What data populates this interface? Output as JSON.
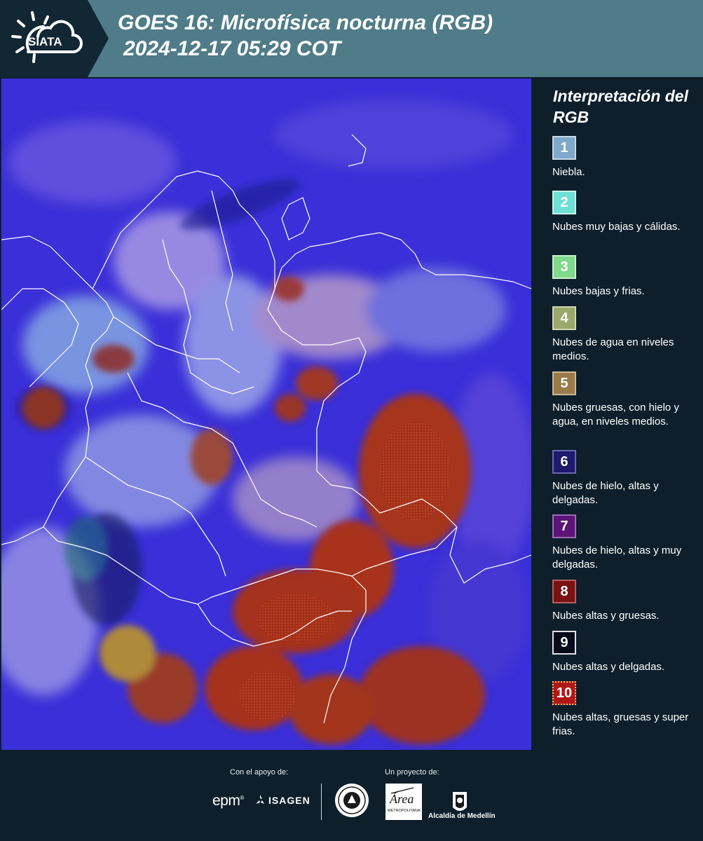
{
  "header": {
    "logo_text": "SIATA",
    "title_line1": "GOES 16: Microfísica nocturna (RGB)",
    "title_line2": "2024-12-17 05:29 COT"
  },
  "legend": {
    "title": "Interpretación del RGB",
    "items": [
      {
        "number": "1",
        "label": "Niebla.",
        "color": "#7fa8cc"
      },
      {
        "number": "2",
        "label": "Nubes muy bajas y cálidas.",
        "color": "#6fe0d4"
      },
      {
        "number": "3",
        "label": "Nubes bajas y frias.",
        "color": "#7fd88c"
      },
      {
        "number": "4",
        "label": "Nubes de agua en niveles medios.",
        "color": "#9aa86c"
      },
      {
        "number": "5",
        "label": "Nubes gruesas, con hielo y agua, en niveles medios.",
        "color": "#9b7a4a"
      },
      {
        "number": "6",
        "label": "Nubes de hielo, altas y delgadas.",
        "color": "#1e1a6e"
      },
      {
        "number": "7",
        "label": "Nubes de hielo, altas y muy delgadas.",
        "color": "#5c1478"
      },
      {
        "number": "8",
        "label": "Nubes altas y gruesas.",
        "color": "#7a1212"
      },
      {
        "number": "9",
        "label": "Nubes altas y delgadas.",
        "color": "#0a0a1a"
      },
      {
        "number": "10",
        "label": "Nubes altas, gruesas y super frias.",
        "color": "#b01818"
      }
    ]
  },
  "footer": {
    "support_label": "Con el apoyo de:",
    "project_label": "Un proyecto de:",
    "epm_logo": "epm",
    "isagen_logo": "ISAGEN",
    "amva_logo": "Área",
    "amva_sub": "METROPOLITANA",
    "medellin_logo": "Alcaldía de Medellín"
  },
  "icons": {
    "siata": "sun-cloud-logo",
    "isagen": "triangle-mark-icon",
    "seal": "round-seal-icon",
    "medellin": "coat-of-arms-icon"
  }
}
